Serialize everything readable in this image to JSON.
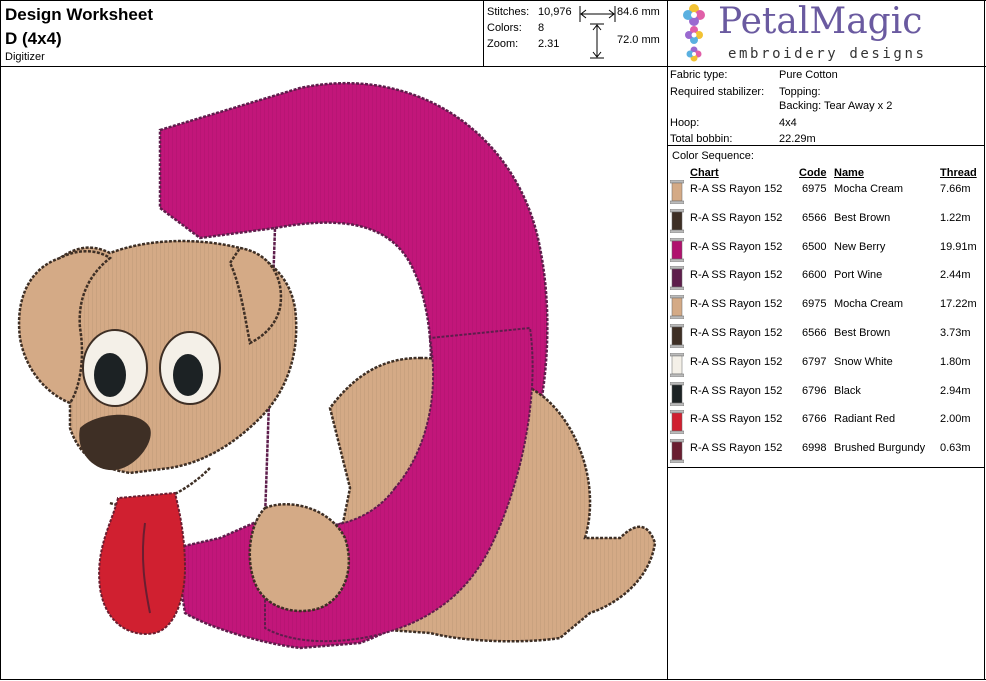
{
  "header": {
    "title": "Design Worksheet",
    "design_name": "D (4x4)",
    "role": "Digitizer"
  },
  "stats": {
    "stitches_label": "Stitches:",
    "stitches": "10,976",
    "colors_label": "Colors:",
    "colors": "8",
    "zoom_label": "Zoom:",
    "zoom": "2.31",
    "width": "84.6 mm",
    "height": "72.0 mm"
  },
  "logo": {
    "word": "PetalMagic",
    "tagline": "embroidery designs"
  },
  "spec": {
    "fabric_label": "Fabric type:",
    "fabric": "Pure Cotton",
    "stabilizer_label": "Required stabilizer:",
    "topping": "Topping:",
    "backing": "Backing: Tear Away x 2",
    "hoop_label": "Hoop:",
    "hoop": "4x4",
    "bobbin_label": "Total bobbin:",
    "bobbin": "22.29m"
  },
  "color_sequence": {
    "label": "Color Sequence:",
    "headers": {
      "chart": "Chart",
      "code": "Code",
      "name": "Name",
      "thread": "Thread"
    },
    "rows": [
      {
        "chart": "R-A SS Rayon 152",
        "code": "6975",
        "name": "Mocha Cream",
        "thread": "7.66m",
        "color": "#d4aa86"
      },
      {
        "chart": "R-A SS Rayon 152",
        "code": "6566",
        "name": "Best Brown",
        "thread": "1.22m",
        "color": "#3e2f25"
      },
      {
        "chart": "R-A SS Rayon 152",
        "code": "6500",
        "name": "New Berry",
        "thread": "19.91m",
        "color": "#b0126e"
      },
      {
        "chart": "R-A SS Rayon 152",
        "code": "6600",
        "name": "Port Wine",
        "thread": "2.44m",
        "color": "#5e1e4c"
      },
      {
        "chart": "R-A SS Rayon 152",
        "code": "6975",
        "name": "Mocha Cream",
        "thread": "17.22m",
        "color": "#d4aa86"
      },
      {
        "chart": "R-A SS Rayon 152",
        "code": "6566",
        "name": "Best Brown",
        "thread": "3.73m",
        "color": "#3e2f25"
      },
      {
        "chart": "R-A SS Rayon 152",
        "code": "6797",
        "name": "Snow White",
        "thread": "1.80m",
        "color": "#f4f0e8"
      },
      {
        "chart": "R-A SS Rayon 152",
        "code": "6796",
        "name": "Black",
        "thread": "2.94m",
        "color": "#1c2224"
      },
      {
        "chart": "R-A SS Rayon 152",
        "code": "6766",
        "name": "Radiant Red",
        "thread": "2.00m",
        "color": "#d02030"
      },
      {
        "chart": "R-A SS Rayon 152",
        "code": "6998",
        "name": "Brushed Burgundy",
        "thread": "0.63m",
        "color": "#6a1e30"
      }
    ]
  }
}
